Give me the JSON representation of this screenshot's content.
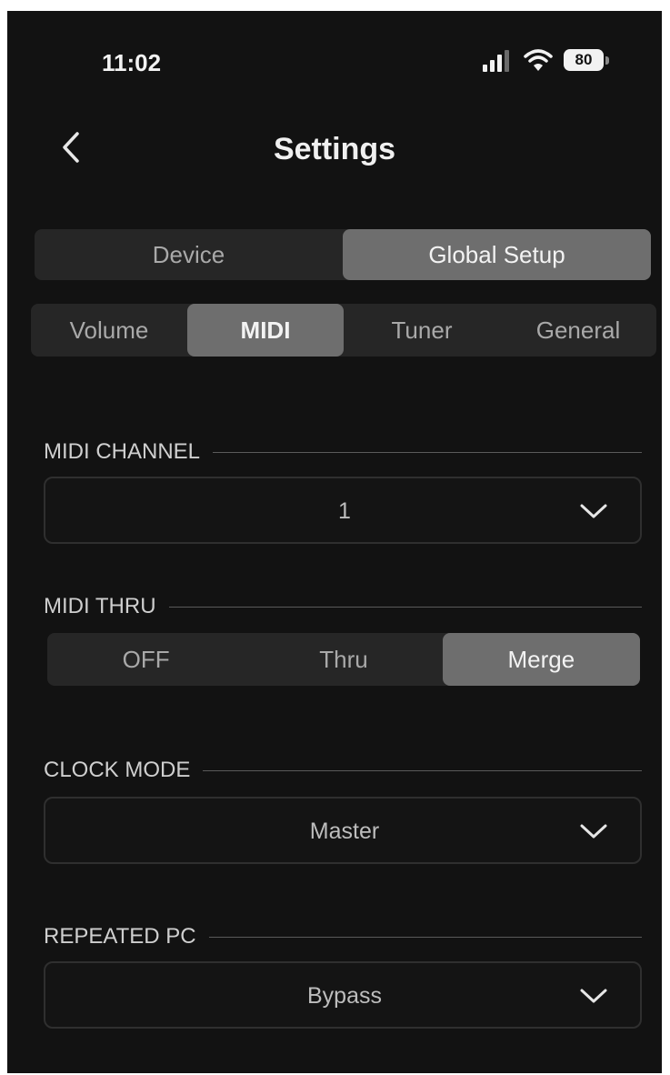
{
  "status_bar": {
    "time": "11:02",
    "battery": "80",
    "icons": [
      "signal-icon",
      "wifi-icon",
      "battery-icon"
    ]
  },
  "header": {
    "title": "Settings",
    "back_icon": "chevron-left-icon"
  },
  "top_tabs": {
    "items": [
      "Device",
      "Global Setup"
    ],
    "active": "Global Setup"
  },
  "sub_tabs": {
    "items": [
      "Volume",
      "MIDI",
      "Tuner",
      "General"
    ],
    "active": "MIDI"
  },
  "midi_channel": {
    "label": "MIDI CHANNEL",
    "value": "1",
    "icon": "chevron-down-icon"
  },
  "midi_thru": {
    "label": "MIDI THRU",
    "options": [
      "OFF",
      "Thru",
      "Merge"
    ],
    "active": "Merge"
  },
  "clock_mode": {
    "label": "CLOCK MODE",
    "value": "Master",
    "icon": "chevron-down-icon"
  },
  "repeated_pc": {
    "label": "REPEATED PC",
    "value": "Bypass",
    "icon": "chevron-down-icon"
  },
  "colors": {
    "background": "#121212",
    "segment_bg": "#262626",
    "segment_active": "#6e6e6e",
    "text": "#cfcfcf"
  }
}
